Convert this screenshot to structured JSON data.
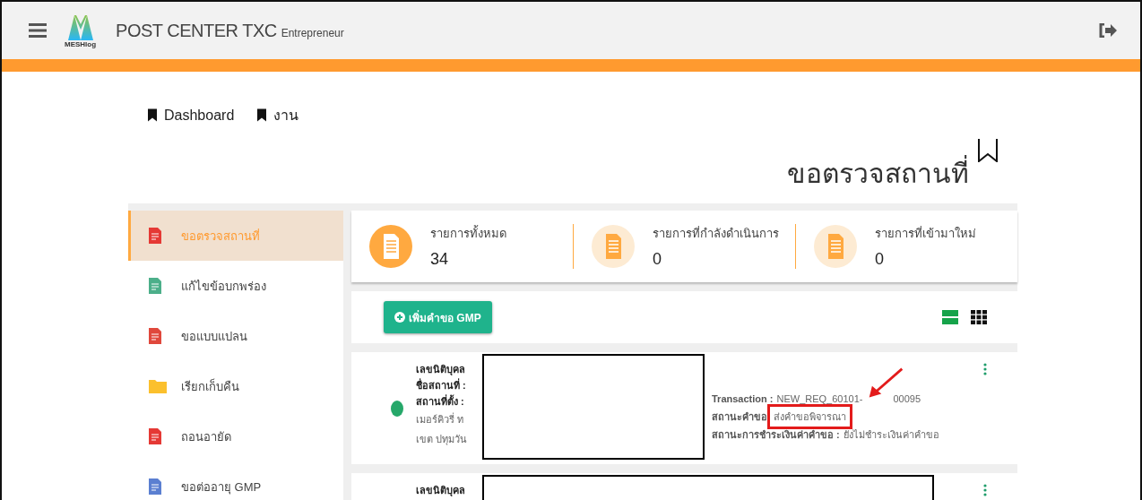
{
  "header": {
    "logo_text": "MESHlog",
    "title": "POST CENTER TXC",
    "subtitle": "Entrepreneur"
  },
  "breadcrumb": [
    {
      "label": "Dashboard"
    },
    {
      "label": "งาน"
    }
  ],
  "page_title": "ขอตรวจสถานที่",
  "sidebar": {
    "items": [
      {
        "label": "ขอตรวจสถานที่",
        "selected": true,
        "kind": "document",
        "color": "#e53935"
      },
      {
        "label": "แก้ไขข้อบกพร่อง",
        "selected": false,
        "kind": "document",
        "color": "#4caf8a"
      },
      {
        "label": "ขอแบบแปลน",
        "selected": false,
        "kind": "document",
        "color": "#e0483c"
      },
      {
        "label": "เรียกเก็บคืน",
        "selected": false,
        "kind": "folder",
        "color": "#fbc02d"
      },
      {
        "label": "ถอนอายัด",
        "selected": false,
        "kind": "document",
        "color": "#e53935"
      },
      {
        "label": "ขอต่ออายุ GMP",
        "selected": false,
        "kind": "document",
        "color": "#5b7fd1"
      }
    ]
  },
  "stats": [
    {
      "label": "รายการทั้งหมด",
      "value": "34",
      "kind": "solid"
    },
    {
      "label": "รายการที่กำลังดำเนินการ",
      "value": "0",
      "kind": "light"
    },
    {
      "label": "รายการที่เข้ามาใหม่",
      "value": "0",
      "kind": "light"
    }
  ],
  "toolbar": {
    "add_button": "เพิ่มคำขอ GMP",
    "views": [
      {
        "kind": "list",
        "selected": true
      },
      {
        "kind": "grid",
        "selected": false
      }
    ]
  },
  "requests": [
    {
      "color": "#26a86a",
      "fields": [
        {
          "label": "เลขนิติบุคล"
        },
        {
          "label": "ชื่อสถานที่ :"
        },
        {
          "label": "สถานที่ตั้ง :"
        }
      ],
      "address_lines": [
        "เมอร์คิวรี่ ท",
        "เขต ปทุมวัน"
      ],
      "transaction_label": "Transaction :",
      "transaction_value": "NEW_REQ_60101-",
      "transaction_tail": "00095",
      "status_label": "สถานะคำขอ",
      "status_value": "ส่งคำขอพิจารณา",
      "status_highlighted": true,
      "payment_label": "สถานะการชำระเงินค่าคำขอ :",
      "payment_value": "ยังไม่ชำระเงินค่าคำขอ"
    },
    {
      "fields": [
        {
          "label": "เลขนิติบุคล"
        }
      ]
    }
  ]
}
